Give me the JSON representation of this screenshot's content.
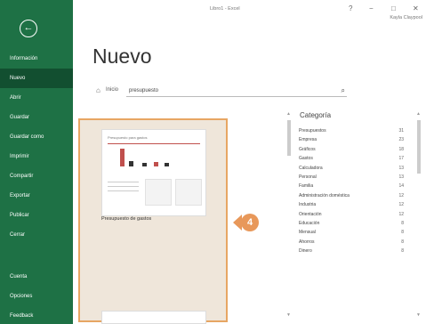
{
  "window": {
    "title": "Libro1 - Excel",
    "help": "?",
    "minimize": "−",
    "restore": "□",
    "close": "✕",
    "user": "Kayla Claypool"
  },
  "sidebar": {
    "back": "←",
    "items": [
      {
        "label": "Información"
      },
      {
        "label": "Nuevo"
      },
      {
        "label": "Abrir"
      },
      {
        "label": "Guardar"
      },
      {
        "label": "Guardar como"
      },
      {
        "label": "Imprimir"
      },
      {
        "label": "Compartir"
      },
      {
        "label": "Exportar"
      },
      {
        "label": "Publicar"
      },
      {
        "label": "Cerrar"
      }
    ],
    "bottom_items": [
      {
        "label": "Cuenta"
      },
      {
        "label": "Opciones"
      },
      {
        "label": "Feedback"
      }
    ]
  },
  "main": {
    "title": "Nuevo",
    "start_label": "Inicio",
    "search_value": "presupuesto"
  },
  "template": {
    "thumb_title": "Presupuesto para gastos",
    "caption": "Presupuesto de gastos"
  },
  "callout": "4",
  "categories": {
    "heading": "Categoría",
    "items": [
      {
        "name": "Presupuestos",
        "count": "31"
      },
      {
        "name": "Empresa",
        "count": "23"
      },
      {
        "name": "Gráficos",
        "count": "18"
      },
      {
        "name": "Gastos",
        "count": "17"
      },
      {
        "name": "Calculadora",
        "count": "13"
      },
      {
        "name": "Personal",
        "count": "13"
      },
      {
        "name": "Familia",
        "count": "14"
      },
      {
        "name": "Administración doméstica",
        "count": "12"
      },
      {
        "name": "Industria",
        "count": "12"
      },
      {
        "name": "Orientación",
        "count": "12"
      },
      {
        "name": "Educación",
        "count": "8"
      },
      {
        "name": "Mensual",
        "count": "8"
      },
      {
        "name": "Ahorros",
        "count": "8"
      },
      {
        "name": "Dinero",
        "count": "8"
      }
    ]
  },
  "colors": {
    "sidebar": "#1e7145",
    "sidebar_selected": "#124f30",
    "highlight": "#e7a663"
  }
}
